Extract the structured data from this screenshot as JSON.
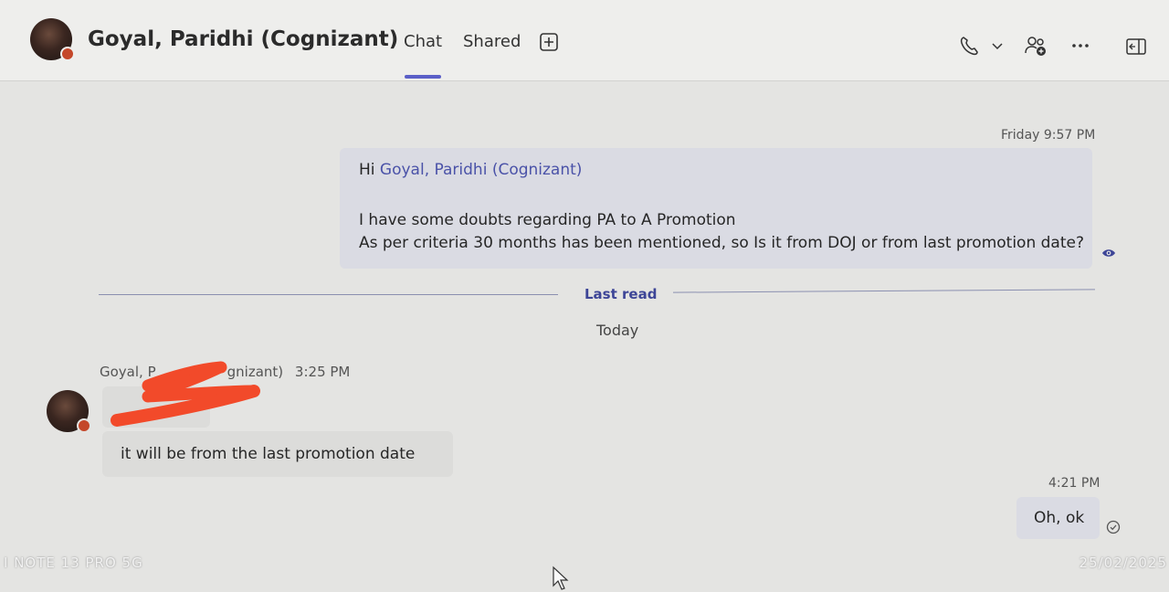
{
  "header": {
    "title": "Goyal, Paridhi (Cognizant)",
    "tabs": [
      {
        "label": "Chat",
        "active": true
      },
      {
        "label": "Shared",
        "active": false
      }
    ],
    "add_tab_icon": "plus-box-icon",
    "call_icon": "phone-icon",
    "call_dropdown_icon": "chevron-down-icon",
    "people_icon": "people-add-icon",
    "more_icon": "more-icon",
    "panel_icon": "side-panel-icon"
  },
  "messages": {
    "outgoing_1": {
      "timestamp": "Friday 9:57 PM",
      "greeting": "Hi",
      "mention": "Goyal, Paridhi (Cognizant)",
      "line1": "I have some doubts regarding PA to A Promotion",
      "line2": "As per criteria 30 months has been mentioned, so Is it from DOJ or from last promotion date?",
      "status_icon": "seen-eye-icon"
    },
    "divider": {
      "last_read": "Last read",
      "day": "Today"
    },
    "incoming_1": {
      "sender_start": "Goyal, P",
      "sender_end": "gnizant)",
      "time": "3:25 PM",
      "reply": "it will be from the last promotion date"
    },
    "outgoing_2": {
      "timestamp": "4:21 PM",
      "text": "Oh, ok",
      "status_icon": "sent-check-icon"
    }
  },
  "overlay": {
    "device_label": "I NOTE 13 PRO 5G",
    "date_stamp": "25/02/2025"
  },
  "colors": {
    "accent": "#5b5fc7",
    "mention": "#4a52a8",
    "presence": "#c4472a",
    "redaction": "#f24a2a"
  }
}
